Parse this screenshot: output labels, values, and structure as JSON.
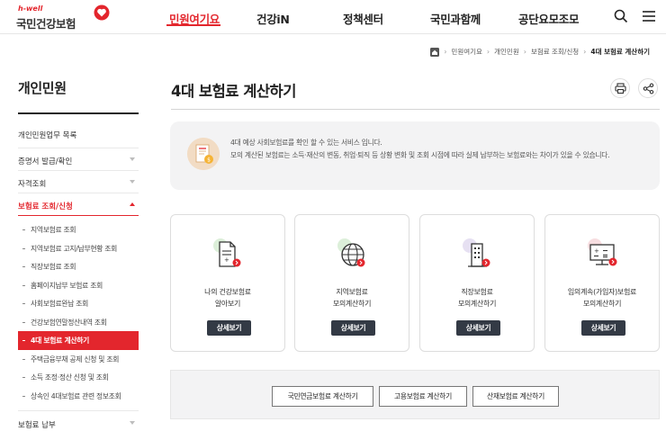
{
  "header": {
    "logo_sub": "h-well",
    "logo_name": "국민건강보험",
    "nav": [
      "민원여기요",
      "건강iN",
      "정책센터",
      "국민과함께",
      "공단요모조모"
    ],
    "active_index": 0,
    "icons": [
      "search-icon",
      "menu-icon"
    ]
  },
  "breadcrumb": {
    "items": [
      "민원여기요",
      "개인민원",
      "보험료 조회/신청"
    ],
    "current": "4대 보험료 계산하기"
  },
  "sidebar": {
    "title": "개인민원",
    "items": [
      "개인민원업무 목록",
      "증명서 발급/확인",
      "자격조회"
    ],
    "open_item": "보험료 조회/신청",
    "sub_items": [
      "지역보험료 조회",
      "지역보험료 고지/납부현황 조회",
      "직장보험료 조회",
      "홈페이지납부 보험료 조회",
      "사회보험료완납 조회",
      "건강보험연말정산내역 조회",
      "4대 보험료 계산하기",
      "주택금융부채 공제 신청 및 조회",
      "소득 조정·정산 신청 및 조회",
      "상속인 4대보험료 관련 정보조회"
    ],
    "active_sub_index": 6,
    "last_item": "보험료 납부"
  },
  "main": {
    "title": "4대 보험료 계산하기",
    "tools": [
      "print-icon",
      "share-icon"
    ],
    "notice": {
      "line1": "4대 예상 사회보험료를 확인 할 수 있는 서비스 입니다.",
      "line2": "모의 계산된 보험료는 소득·재산의 변동, 취업·퇴직 등 상황 변화 및 조회 시점에 따라 실제 납부하는 보험료와는 차이가 있을 수 있습니다."
    },
    "cards": [
      {
        "line1": "나의 건강보험료",
        "line2": "알아보기",
        "button": "상세보기",
        "icon": "document-icon"
      },
      {
        "line1": "지역보험료",
        "line2": "모의계산하기",
        "button": "상세보기",
        "icon": "globe-icon"
      },
      {
        "line1": "직장보험료",
        "line2": "모의계산하기",
        "button": "상세보기",
        "icon": "building-icon"
      },
      {
        "line1": "임의계속(가입자)보험료",
        "line2": "모의계산하기",
        "button": "상세보기",
        "icon": "calculator-monitor-icon"
      }
    ],
    "calc_buttons": [
      "국민연금보험료 계산하기",
      "고용보험료 계산하기",
      "산재보험료 계산하기"
    ]
  },
  "colors": {
    "accent": "#e3262d",
    "button_dark": "#333a45",
    "panel_bg": "#f3f3f4"
  }
}
